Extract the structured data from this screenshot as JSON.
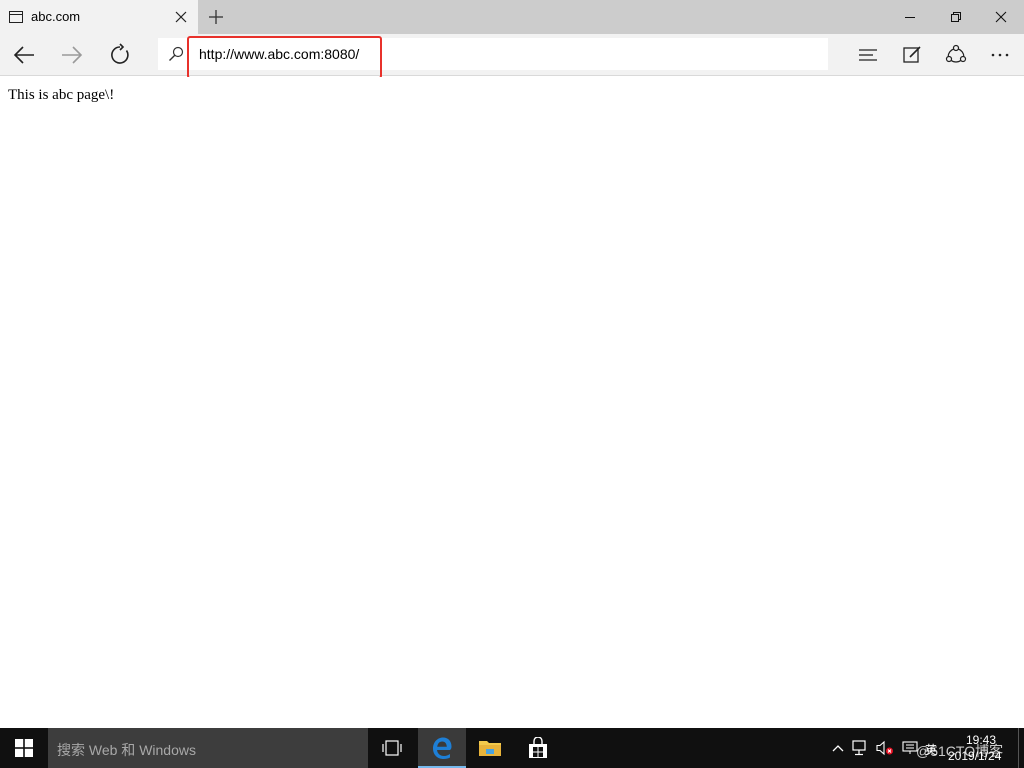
{
  "tab": {
    "title": "abc.com",
    "icon": "tab-page-icon",
    "close_icon": "close-icon"
  },
  "new_tab_icon": "plus-icon",
  "window_controls": [
    "minimize-icon",
    "restore-icon",
    "close-icon"
  ],
  "nav": {
    "back_icon": "arrow-left-icon",
    "forward_icon": "arrow-right-icon",
    "refresh_icon": "refresh-icon"
  },
  "address_bar": {
    "url": "http://www.abc.com:8080/",
    "search_icon": "search-icon",
    "highlight_color": "#e8312b"
  },
  "toolbar_icons": [
    "hub-icon",
    "web-note-icon",
    "share-icon",
    "more-icon"
  ],
  "page": {
    "body_text": "This is abc page\\!"
  },
  "taskbar": {
    "search_placeholder": "搜索 Web 和 Windows",
    "apps": [
      "task-view-icon",
      "edge-icon",
      "file-explorer-icon",
      "store-icon"
    ],
    "active_app": "edge-icon",
    "tray_icons": [
      "chevron-up-icon",
      "network-icon",
      "volume-muted-icon",
      "ime-icon"
    ],
    "language": "英",
    "time": "19:43",
    "date": "2019/1/24",
    "watermark": "@51CTO博客"
  },
  "colors": {
    "tab_strip": "#cccccc",
    "chrome": "#f2f2f2",
    "taskbar": "#101010",
    "search_box": "#3d3d3d",
    "edge_blue": "#1e7fd6"
  }
}
